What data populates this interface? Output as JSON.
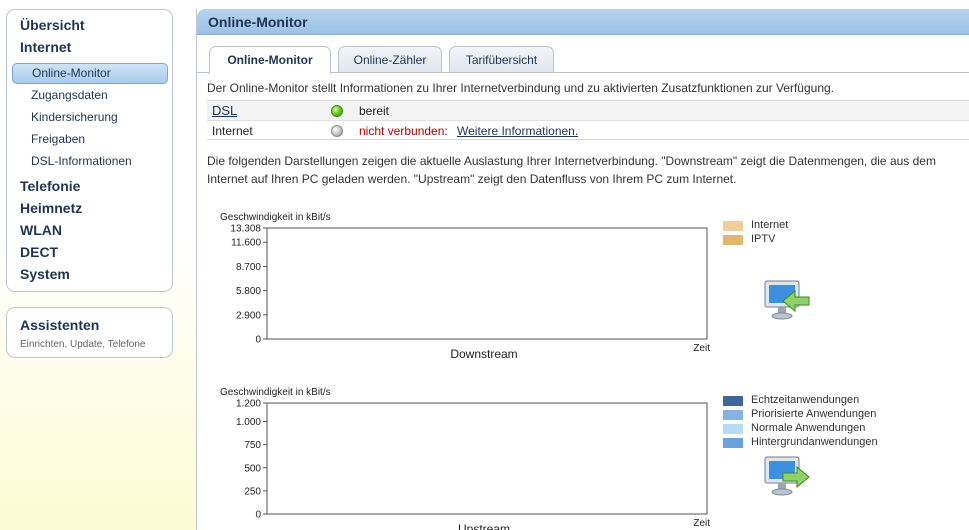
{
  "sidebar": {
    "items": [
      {
        "label": "Übersicht"
      },
      {
        "label": "Internet",
        "children": [
          {
            "label": "Online-Monitor",
            "active": true
          },
          {
            "label": "Zugangsdaten"
          },
          {
            "label": "Kindersicherung"
          },
          {
            "label": "Freigaben"
          },
          {
            "label": "DSL-Informationen"
          }
        ]
      },
      {
        "label": "Telefonie"
      },
      {
        "label": "Heimnetz"
      },
      {
        "label": "WLAN"
      },
      {
        "label": "DECT"
      },
      {
        "label": "System"
      }
    ],
    "assistants": {
      "title": "Assistenten",
      "subtitle": "Einrichten, Update, Telefone"
    }
  },
  "main": {
    "title": "Online-Monitor",
    "tabs": [
      {
        "label": "Online-Monitor",
        "active": true
      },
      {
        "label": "Online-Zähler"
      },
      {
        "label": "Tarifübersicht"
      }
    ],
    "intro": "Der Online-Monitor stellt Informationen zu Ihrer Internetverbindung und zu aktivierten Zusatzfunktionen zur Verfügung.",
    "status": [
      {
        "name": "DSL",
        "led": "green",
        "text": "bereit"
      },
      {
        "name": "Internet",
        "led": "grey",
        "text": "nicht verbunden:",
        "link": "Weitere Informationen."
      }
    ],
    "description": "Die folgenden Darstellungen zeigen die aktuelle Auslastung Ihrer Internetverbindung. \"Downstream\" zeigt die Datenmengen, die aus dem Internet auf Ihren PC geladen werden. \"Upstream\" zeigt den Datenfluss von Ihrem PC zum Internet."
  },
  "colors": {
    "nav_text": "#1f3552",
    "header_blue": "#9cc1e6",
    "page_yellow": "#fdfbd2",
    "error_red": "#b00000"
  },
  "chart_data": [
    {
      "type": "area",
      "xlabel": "Downstream",
      "x_axis_unit": "Zeit",
      "ylabel": "Geschwindigkeit in kBit/s",
      "yticks": [
        0,
        2900,
        5800,
        8700,
        11600,
        13308
      ],
      "ytick_labels": [
        "0",
        "2.900",
        "5.800",
        "8.700",
        "11.600",
        "13.308"
      ],
      "ylim": [
        0,
        13308
      ],
      "grid": false,
      "legend_position": "right",
      "series": [
        {
          "name": "Internet",
          "color": "#f0cf9a",
          "values": []
        },
        {
          "name": "IPTV",
          "color": "#e0b670",
          "values": []
        }
      ],
      "direction": "down"
    },
    {
      "type": "area",
      "xlabel": "Upstream",
      "x_axis_unit": "Zeit",
      "ylabel": "Geschwindigkeit in kBit/s",
      "yticks": [
        0,
        250,
        500,
        750,
        1000,
        1200
      ],
      "ytick_labels": [
        "0",
        "250",
        "500",
        "750",
        "1.000",
        "1.200"
      ],
      "ylim": [
        0,
        1200
      ],
      "grid": false,
      "legend_position": "right",
      "series": [
        {
          "name": "Echtzeitanwendungen",
          "color": "#40679c",
          "values": []
        },
        {
          "name": "Priorisierte Anwendungen",
          "color": "#86b3e3",
          "values": []
        },
        {
          "name": "Normale Anwendungen",
          "color": "#b5dcf7",
          "values": []
        },
        {
          "name": "Hintergrundanwendungen",
          "color": "#6aa3db",
          "values": []
        }
      ],
      "direction": "up"
    }
  ]
}
